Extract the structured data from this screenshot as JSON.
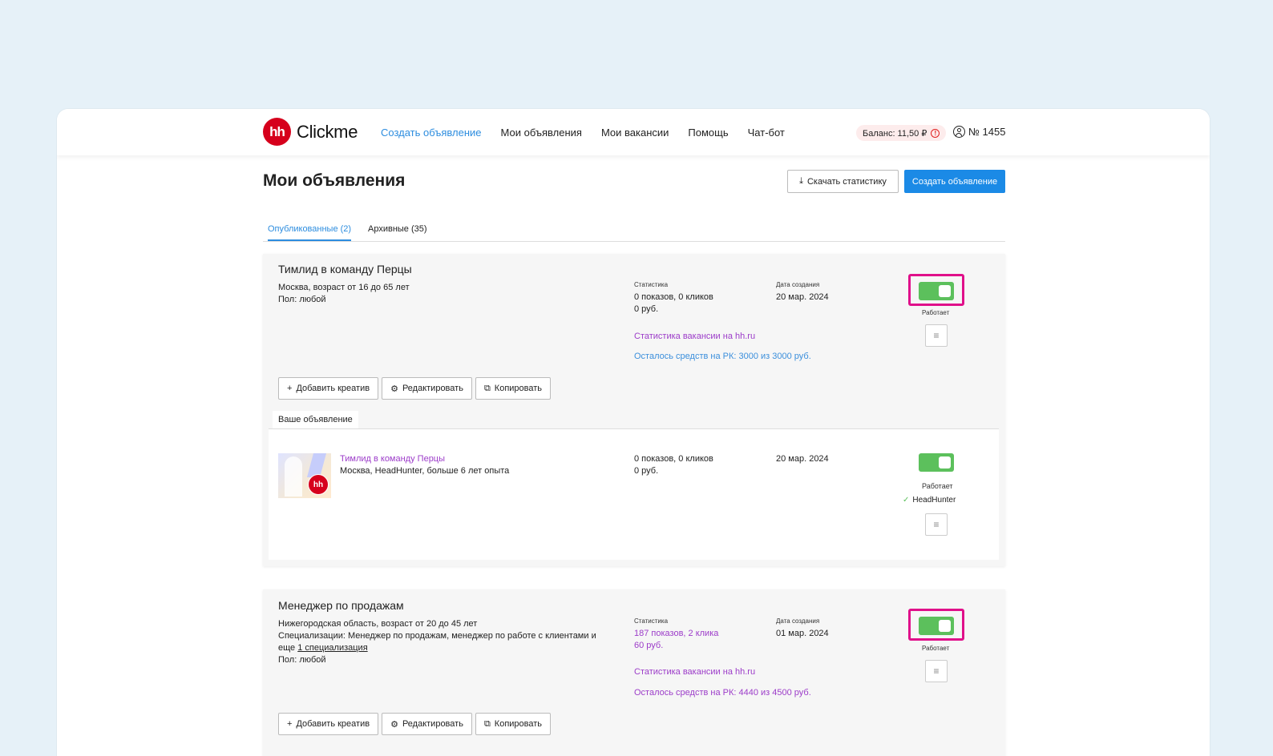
{
  "header": {
    "logo_mark": "hh",
    "logo_text": "Clickme",
    "nav": [
      "Создать объявление",
      "Мои объявления",
      "Мои вакансии",
      "Помощь",
      "Чат-бот"
    ],
    "balance": "Баланс: 11,50 ₽",
    "account": "№ 1455"
  },
  "page": {
    "title": "Мои объявления",
    "download_label": "Скачать статистику",
    "create_label": "Создать объявление",
    "tabs": [
      "Опубликованные (2)",
      "Архивные (35)"
    ]
  },
  "labels": {
    "stats": "Статистика",
    "created": "Дата создания",
    "working": "Работает",
    "add_creative": "Добавить креатив",
    "edit": "Редактировать",
    "copy": "Копировать",
    "your_ad": "Ваше объявление",
    "vacancy_stats": "Статистика вакансии на hh.ru"
  },
  "ads": [
    {
      "title": "Тимлид в команду Перцы",
      "desc1": "Москва, возраст от 16 до 65 лет",
      "desc2": "Пол: любой",
      "stats1": "0 показов, 0 кликов",
      "stats2": "0 руб.",
      "date": "20 мар. 2024",
      "remaining": "Осталось средств на РК: 3000 из 3000 руб.",
      "active": true,
      "creative": {
        "title": "Тимлид в команду Перцы",
        "subtitle": "Москва, HeadHunter, больше 6 лет опыта",
        "stats1": "0 показов, 0 кликов",
        "stats2": "0 руб.",
        "date": "20 мар. 2024",
        "platform": "HeadHunter",
        "logo": "hh",
        "active": true
      }
    },
    {
      "title": "Менеджер по продажам",
      "desc1": "Нижегородская область, возраст от 20 до 45 лет",
      "desc2": "Специализации: Менеджер по продажам, менеджер по работе с клиентами и",
      "desc3_prefix": "еще ",
      "desc3_link": "1 специализация",
      "desc4": "Пол: любой",
      "stats1": "187 показов, 2 клика",
      "stats2": "60 руб.",
      "date": "01 мар. 2024",
      "remaining": "Осталось средств на РК: 4440 из 4500 руб.",
      "active": true
    }
  ],
  "icons": {
    "warn": "!",
    "menu": "≡",
    "check": "✓",
    "plus": "+",
    "gear": "⚙",
    "copy": "⧉",
    "download": "⤓"
  }
}
